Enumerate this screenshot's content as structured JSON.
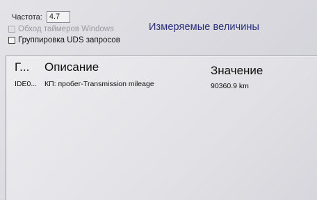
{
  "controls": {
    "frequency_label": "Частота:",
    "frequency_value": "4.7",
    "bypass_timers_label": "Обход таймеров Windows",
    "uds_grouping_label": "Группировка UDS запросов"
  },
  "panel": {
    "title": "Измеряемые величины"
  },
  "table": {
    "columns": [
      "Г...",
      "Описание",
      "Значение"
    ],
    "rows": [
      {
        "id": "IDE0...",
        "description": "КП: пробег-Transmission mileage",
        "value": "90360.9 km"
      }
    ]
  }
}
